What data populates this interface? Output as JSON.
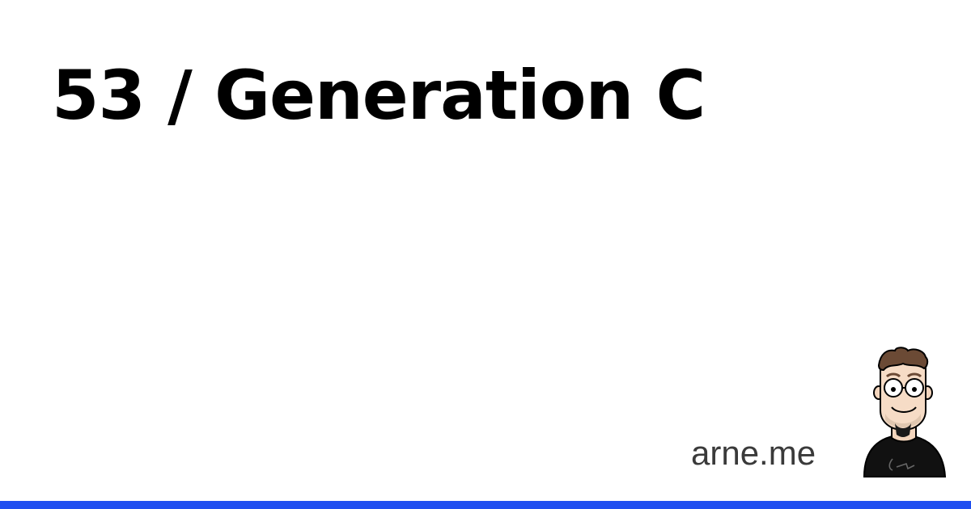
{
  "card": {
    "title": "53 / Generation C",
    "site": "arne.me",
    "avatar_icon": "avatar-illustration",
    "colors": {
      "background": "#ffffff",
      "title": "#000000",
      "site": "#3a3a3a",
      "accent_bar": "#1f4ff0"
    }
  }
}
